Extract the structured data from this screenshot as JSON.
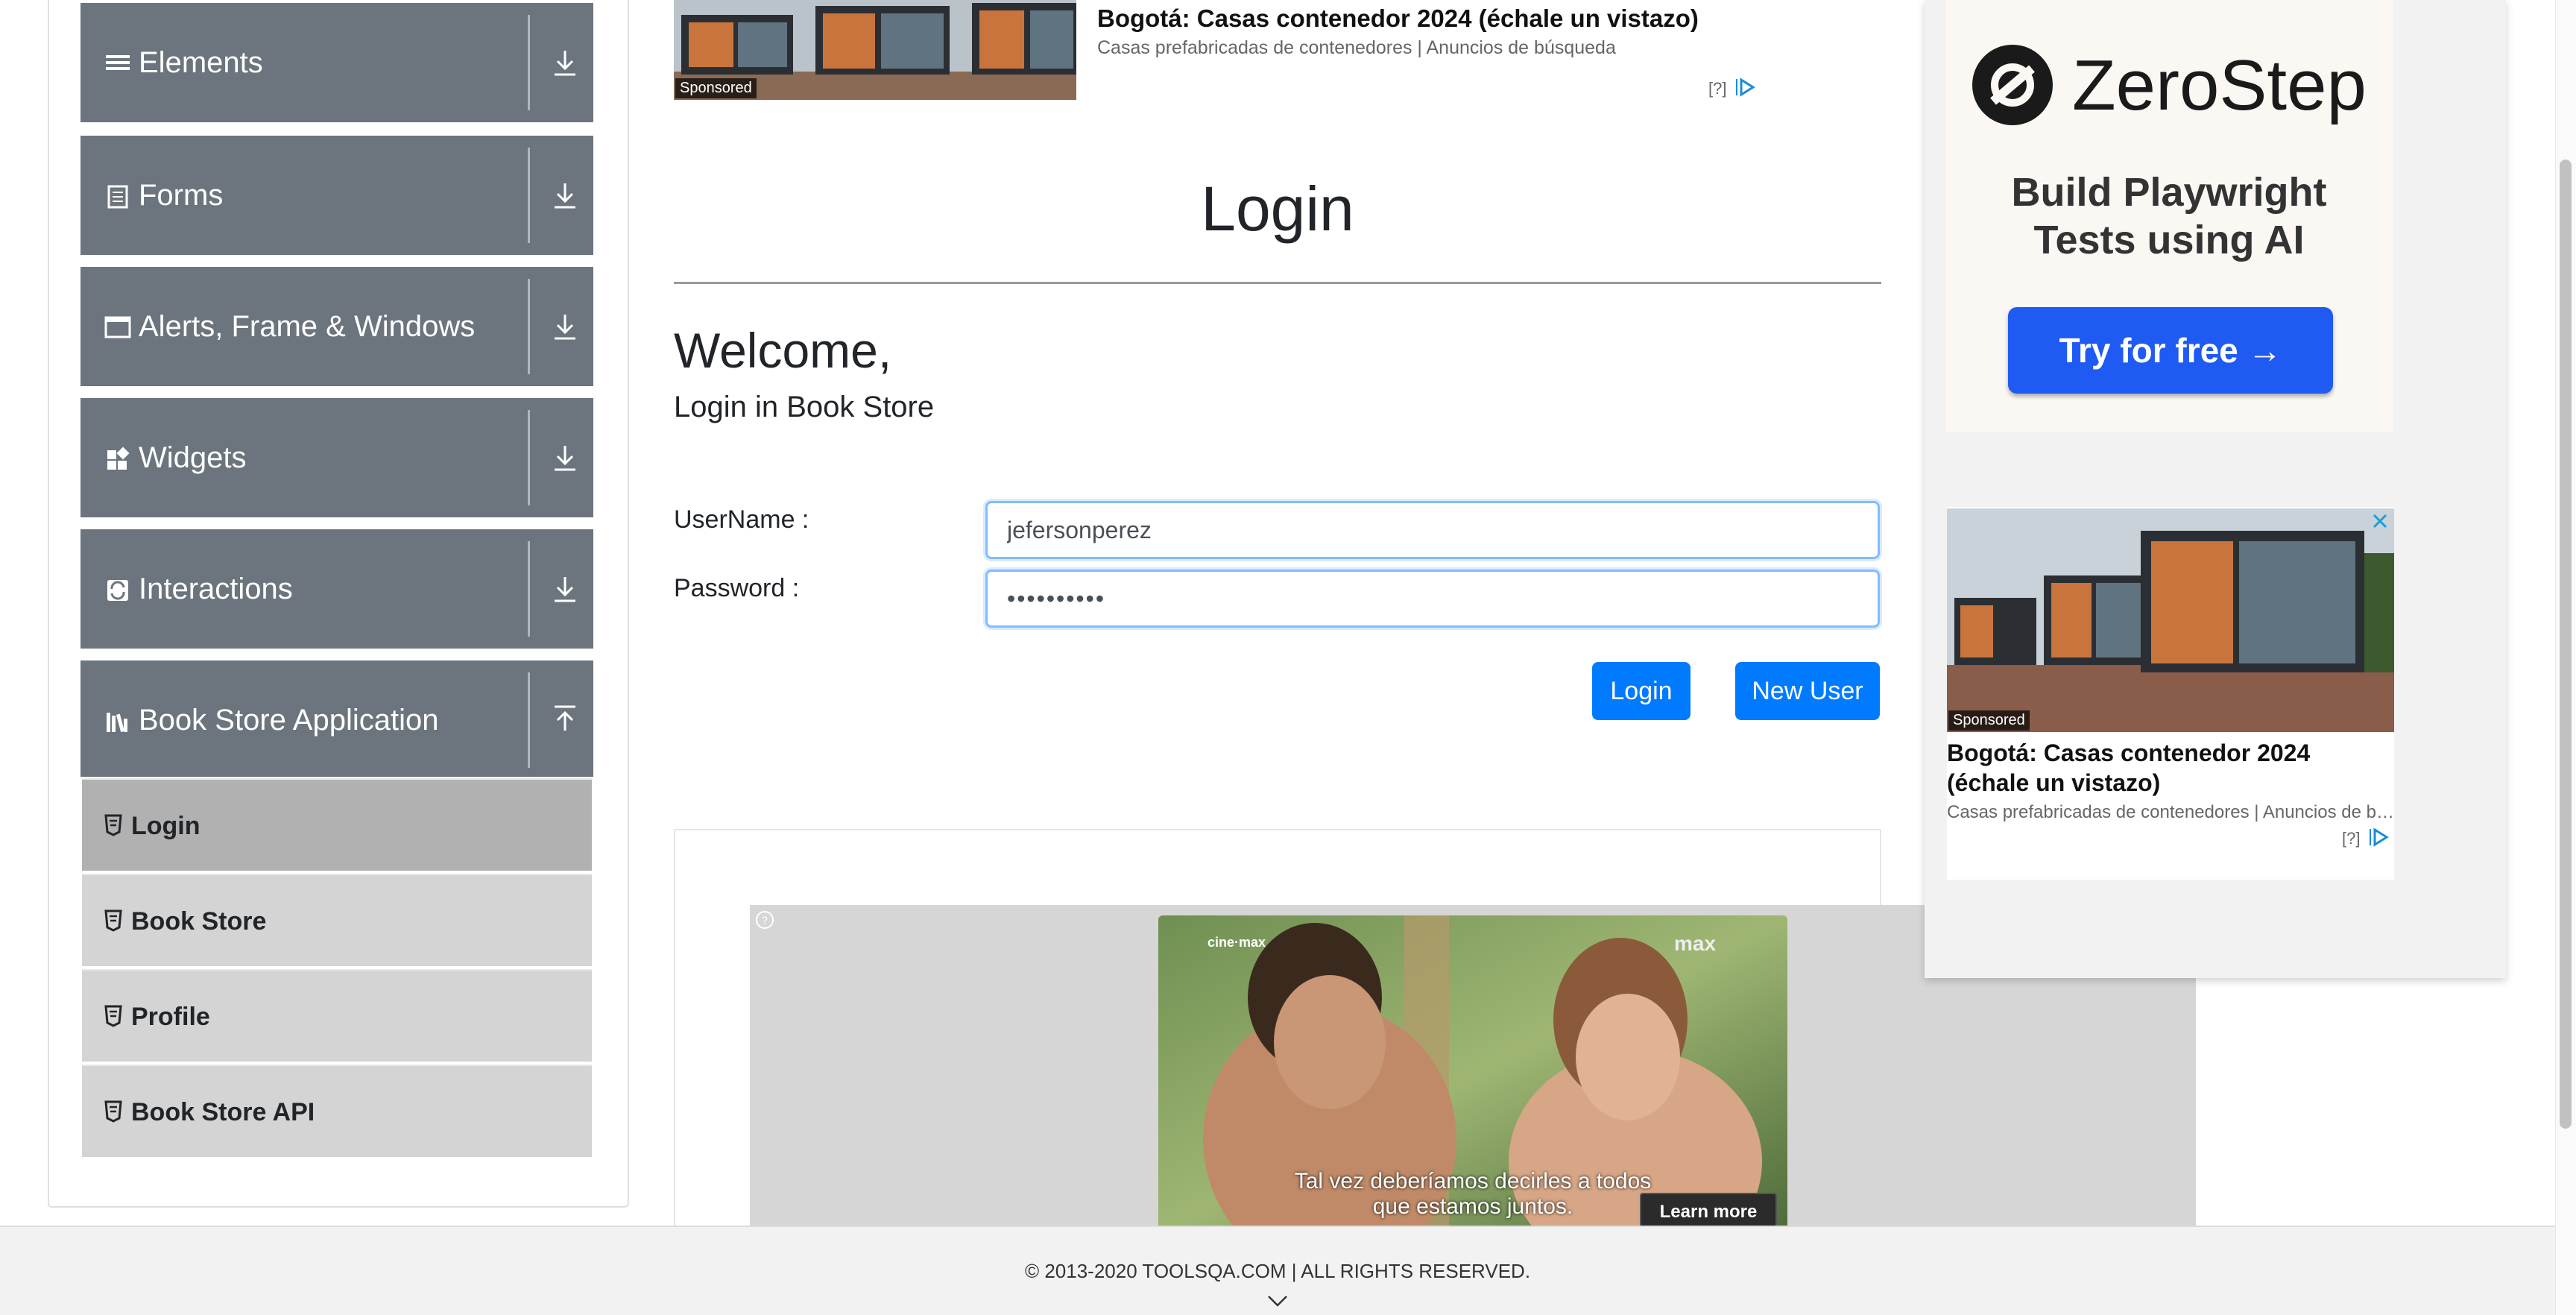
{
  "sidebar": {
    "groups": [
      {
        "label": "Elements",
        "icon": "hamburger-icon"
      },
      {
        "label": "Forms",
        "icon": "form-icon"
      },
      {
        "label": "Alerts, Frame & Windows",
        "icon": "window-icon"
      },
      {
        "label": "Widgets",
        "icon": "widgets-icon"
      },
      {
        "label": "Interactions",
        "icon": "interactions-icon"
      },
      {
        "label": "Book Store Application",
        "icon": "bookstore-icon"
      }
    ],
    "items": [
      {
        "label": "Login"
      },
      {
        "label": "Book Store"
      },
      {
        "label": "Profile"
      },
      {
        "label": "Book Store API"
      }
    ]
  },
  "top_ad": {
    "title": "Bogotá: Casas contenedor 2024 (échale un vistazo)",
    "subtitle": "Casas prefabricadas de contenedores | Anuncios de búsqueda",
    "sponsored": "Sponsored",
    "info": "[?]"
  },
  "main": {
    "title": "Login",
    "welcome": "Welcome,",
    "subtitle": "Login in Book Store",
    "username_label": "UserName :",
    "username_value": "jefersonperez",
    "password_label": "Password :",
    "password_value": "••••••••••",
    "login_button": "Login",
    "new_user_button": "New User"
  },
  "video_ad": {
    "channel": "cine·max",
    "brand": "max",
    "caption_line1": "Tal vez deberíamos decirles a todos",
    "caption_line2": "que estamos juntos.",
    "learn_more": "Learn more"
  },
  "right_ad": {
    "brand": "ZeroStep",
    "tagline_line1": "Build Playwright",
    "tagline_line2": "Tests using AI",
    "cta": "Try for free →",
    "card_title": "Bogotá: Casas contenedor 2024 (échale un vistazo)",
    "card_subtitle": "Casas prefabricadas de contenedores | Anuncios de búsqueda",
    "sponsored": "Sponsored",
    "info": "[?]"
  },
  "footer": {
    "text": "© 2013-2020 TOOLSQA.COM | ALL RIGHTS RESERVED."
  },
  "colors": {
    "sidebar_group": "#6c757d",
    "sidebar_item": "#d4d4d4",
    "sidebar_item_active": "#b1b1b1",
    "primary_button": "#007bff",
    "zerostep_button": "#1f5af2"
  }
}
